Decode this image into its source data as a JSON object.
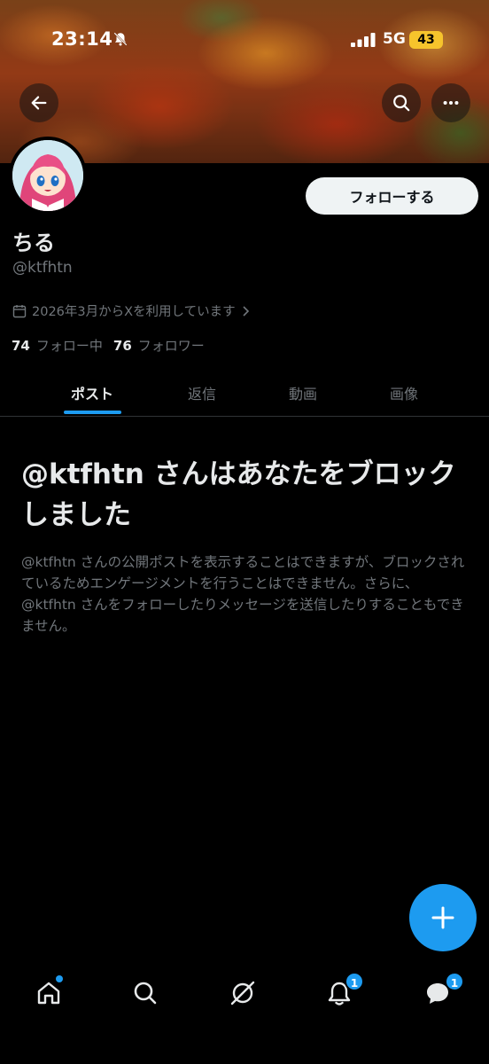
{
  "status": {
    "time": "23:14",
    "network": "5G",
    "battery": "43"
  },
  "profile": {
    "display_name": "ちる",
    "handle": "@ktfhtn",
    "joined": "2026年3月からXを利用しています",
    "following_count": "74",
    "following_label": "フォロー中",
    "followers_count": "76",
    "followers_label": "フォロワー",
    "follow_button": "フォローする"
  },
  "tabs": [
    {
      "label": "ポスト",
      "active": true
    },
    {
      "label": "返信",
      "active": false
    },
    {
      "label": "動画",
      "active": false
    },
    {
      "label": "画像",
      "active": false
    }
  ],
  "blocked": {
    "title": "@ktfhtn さんはあなたをブロックしました",
    "body": "@ktfhtn さんの公開ポストを表示することはできますが、ブロックされているためエンゲージメントを行うことはできません。さらに、@ktfhtn さんをフォローしたりメッセージを送信したりすることもできません。"
  },
  "nav": {
    "items": [
      "home-icon",
      "search-icon",
      "grok-icon",
      "notifications-icon",
      "messages-icon"
    ],
    "notifications_badge": "1",
    "messages_badge": "1"
  },
  "colors": {
    "accent": "#1d9bf0",
    "background": "#000000",
    "muted": "#71767b",
    "battery": "#f6c42c"
  }
}
